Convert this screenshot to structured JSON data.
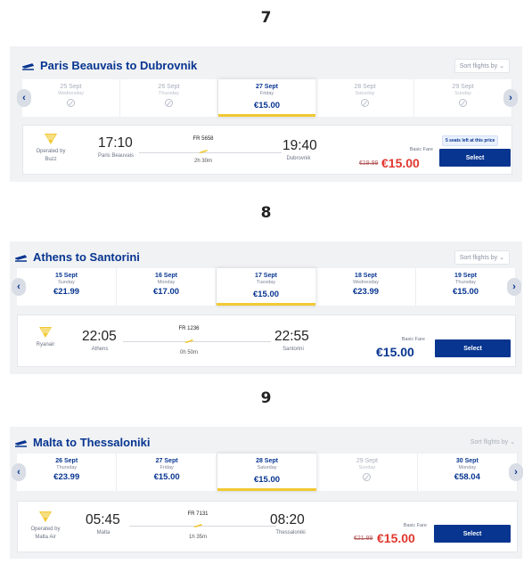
{
  "colors": {
    "primary": "#073590",
    "accent": "#f1c933",
    "sale": "#e0382f",
    "panel": "#f1f2f4"
  },
  "icons": [
    "plane-icon",
    "chevron-left-icon",
    "chevron-right-icon",
    "unavailable-icon",
    "harp-logo-icon",
    "chevron-down-icon"
  ],
  "sections": [
    {
      "number": "7",
      "route": "Paris Beauvais to Dubrovnik",
      "sort_label": "Sort flights by",
      "dates": [
        {
          "date": "25 Sept",
          "day": "Wednesday",
          "price": ""
        },
        {
          "date": "26 Sept",
          "day": "Thursday",
          "price": ""
        },
        {
          "date": "27 Sept",
          "day": "Friday",
          "price": "€15.00"
        },
        {
          "date": "28 Sept",
          "day": "Saturday",
          "price": ""
        },
        {
          "date": "29 Sept",
          "day": "Sunday",
          "price": ""
        }
      ],
      "flight": {
        "operator": "Operated by Buzz",
        "depart_time": "17:10",
        "depart_place": "Paris Beauvais",
        "flight_number": "FR 5658",
        "duration": "2h 30m",
        "arrive_time": "19:40",
        "arrive_place": "Dubrovnik",
        "fare_type": "Basic Fare",
        "old_price": "€19.99",
        "price": "€15.00",
        "seats_note": "5 seats left at this price",
        "select_label": "Select"
      }
    },
    {
      "number": "8",
      "route": "Athens to Santorini",
      "sort_label": "Sort flights by",
      "dates": [
        {
          "date": "15 Sept",
          "day": "Sunday",
          "price": "€21.99"
        },
        {
          "date": "16 Sept",
          "day": "Monday",
          "price": "€17.00"
        },
        {
          "date": "17 Sept",
          "day": "Tuesday",
          "price": "€15.00"
        },
        {
          "date": "18 Sept",
          "day": "Wednesday",
          "price": "€23.99"
        },
        {
          "date": "19 Sept",
          "day": "Thursday",
          "price": "€15.00"
        }
      ],
      "flight": {
        "operator": "Ryanair",
        "depart_time": "22:05",
        "depart_place": "Athens",
        "flight_number": "FR 1236",
        "duration": "0h 50m",
        "arrive_time": "22:55",
        "arrive_place": "Santorini",
        "fare_type": "Basic Fare",
        "price": "€15.00",
        "select_label": "Select"
      }
    },
    {
      "number": "9",
      "route": "Malta to Thessaloniki",
      "sort_label": "Sort flights by",
      "dates": [
        {
          "date": "26 Sept",
          "day": "Thursday",
          "price": "€23.99"
        },
        {
          "date": "27 Sept",
          "day": "Friday",
          "price": "€15.00"
        },
        {
          "date": "28 Sept",
          "day": "Saturday",
          "price": "€15.00"
        },
        {
          "date": "29 Sept",
          "day": "Sunday",
          "price": ""
        },
        {
          "date": "30 Sept",
          "day": "Monday",
          "price": "€58.04"
        }
      ],
      "flight": {
        "operator": "Operated by Malta Air",
        "depart_time": "05:45",
        "depart_place": "Malta",
        "flight_number": "FR 7131",
        "duration": "1h 35m",
        "arrive_time": "08:20",
        "arrive_place": "Thessaloniki",
        "fare_type": "Basic Fare",
        "old_price": "€21.99",
        "price": "€15.00",
        "select_label": "Select"
      }
    }
  ]
}
